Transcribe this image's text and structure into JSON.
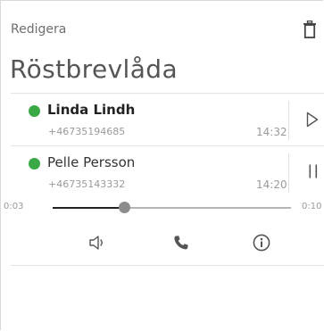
{
  "header": {
    "edit_label": "Redigera",
    "title": "Röstbrevlåda",
    "trash_icon": "trash-icon"
  },
  "messages": [
    {
      "name": "Linda Lindh",
      "number": "+46735194685",
      "time": "14:32",
      "unread": true,
      "action_icon": "play-icon"
    },
    {
      "name": "Pelle Persson",
      "number": "+46735143332",
      "time": "14:20",
      "unread": false,
      "action_icon": "pause-icon"
    }
  ],
  "player": {
    "elapsed": "0:03",
    "duration": "0:10",
    "progress": 0.3,
    "icons": [
      "speaker-icon",
      "phone-icon",
      "info-icon"
    ]
  },
  "colors": {
    "status_green": "#3aa845",
    "text_dark": "#333333",
    "text_muted": "#9a9a9a"
  }
}
